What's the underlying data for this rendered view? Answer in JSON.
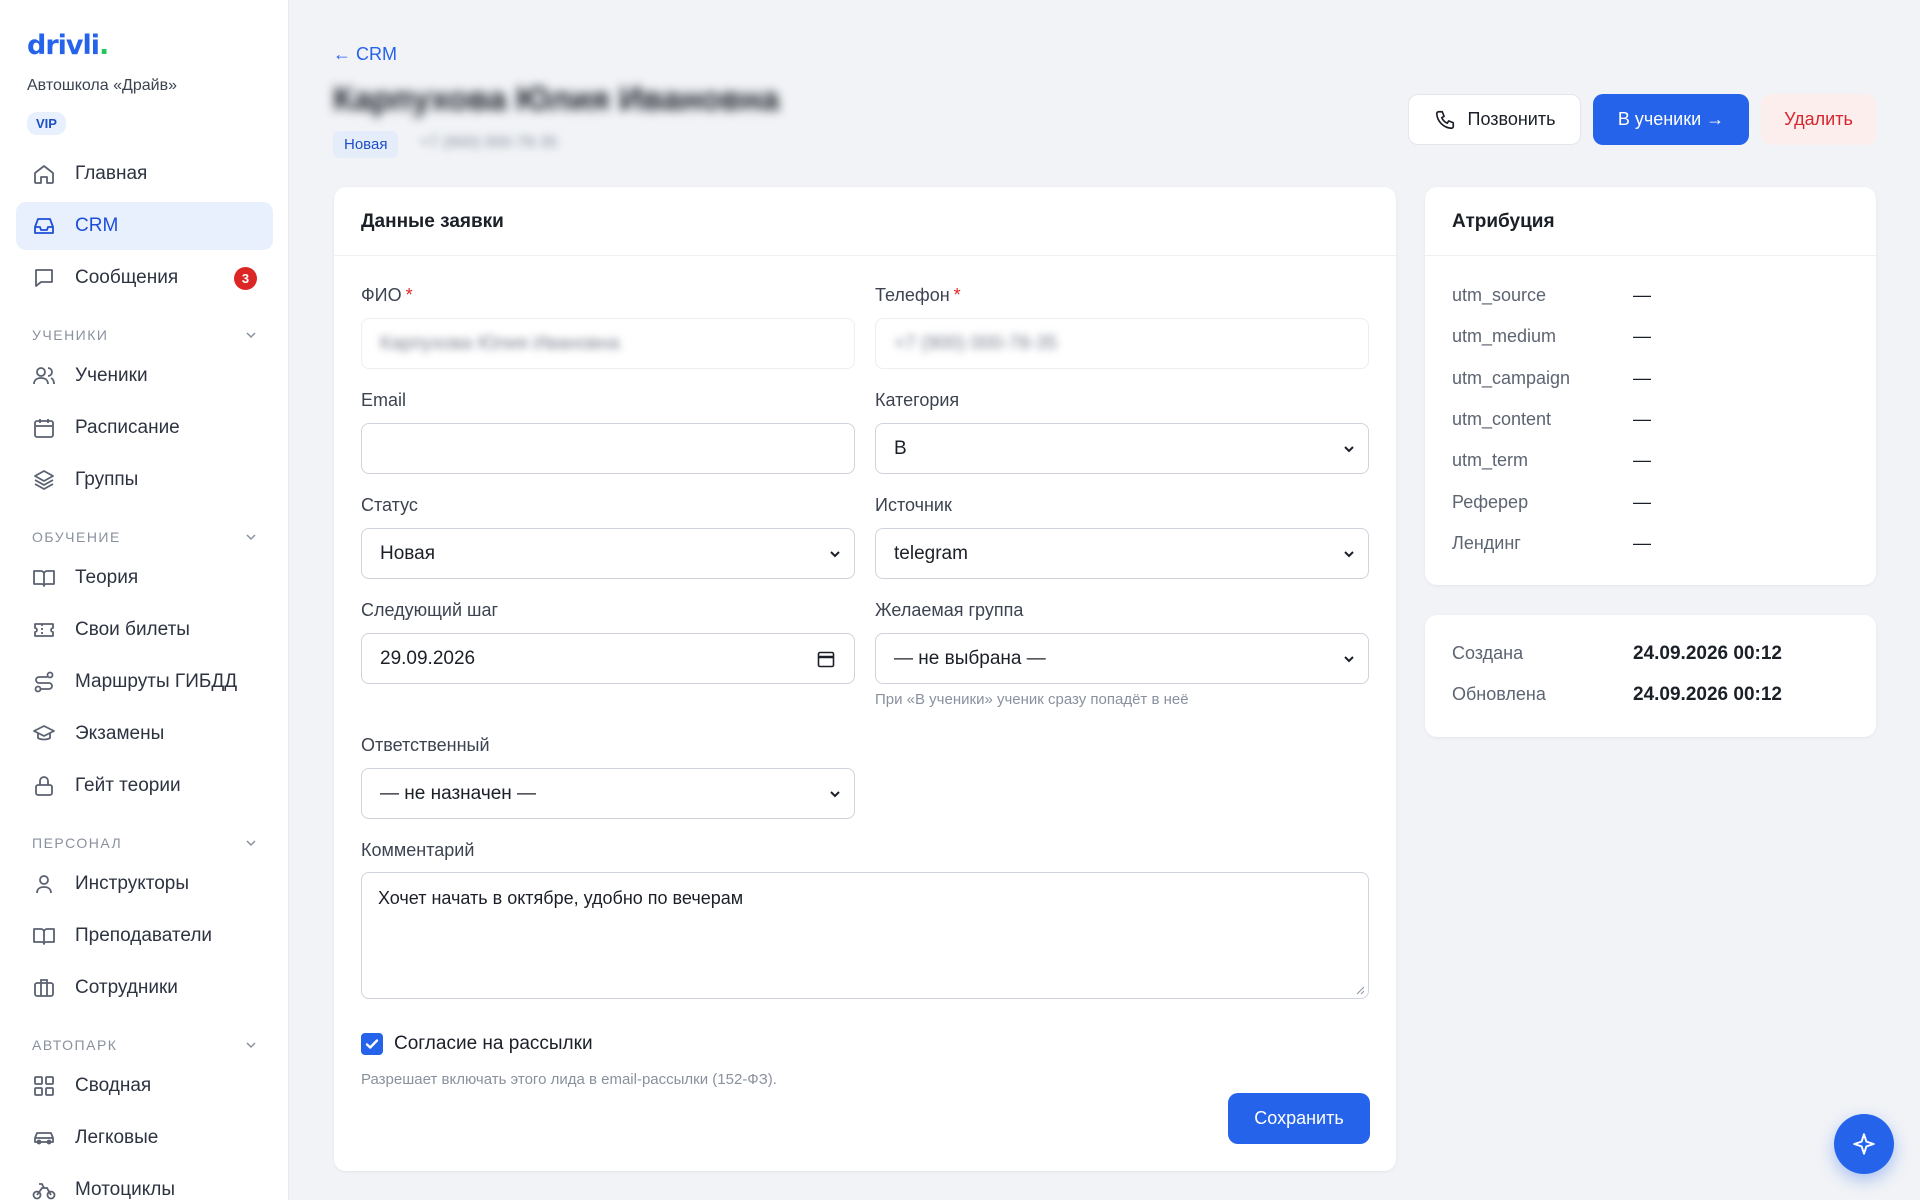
{
  "sidebar": {
    "logo": "drivli",
    "logo_dot": ".",
    "school": "Автошкола «Драйв»",
    "badge": "VIP",
    "top_items": [
      {
        "label": "Главная",
        "icon": "home-icon"
      },
      {
        "label": "CRM",
        "icon": "inbox-icon",
        "active": true
      },
      {
        "label": "Сообщения",
        "icon": "message-icon",
        "count": "3"
      }
    ],
    "sections": [
      {
        "title": "УЧЕНИКИ",
        "items": [
          {
            "label": "Ученики",
            "icon": "users-icon"
          },
          {
            "label": "Расписание",
            "icon": "calendar-icon"
          },
          {
            "label": "Группы",
            "icon": "layers-icon"
          }
        ]
      },
      {
        "title": "ОБУЧЕНИЕ",
        "items": [
          {
            "label": "Теория",
            "icon": "book-icon"
          },
          {
            "label": "Свои билеты",
            "icon": "ticket-icon"
          },
          {
            "label": "Маршруты ГИБДД",
            "icon": "route-icon"
          },
          {
            "label": "Экзамены",
            "icon": "graduation-cap-icon"
          },
          {
            "label": "Гейт теории",
            "icon": "lock-icon"
          }
        ]
      },
      {
        "title": "ПЕРСОНАЛ",
        "items": [
          {
            "label": "Инструкторы",
            "icon": "user-icon"
          },
          {
            "label": "Преподаватели",
            "icon": "book-open-icon"
          },
          {
            "label": "Сотрудники",
            "icon": "briefcase-icon"
          }
        ]
      },
      {
        "title": "АВТОПАРК",
        "items": [
          {
            "label": "Сводная",
            "icon": "grid-icon"
          },
          {
            "label": "Легковые",
            "icon": "car-icon"
          },
          {
            "label": "Мотоциклы",
            "icon": "bike-icon"
          }
        ]
      }
    ]
  },
  "header": {
    "back": "← CRM",
    "title": "Карпухова Юлия Ивановна",
    "status": "Новая",
    "phone": "+7 (900) 000-78-35",
    "call_label": "Позвонить",
    "students_label": "В ученики →",
    "delete_label": "Удалить"
  },
  "form": {
    "title": "Данные заявки",
    "fio_label": "ФИО",
    "fio_value": "Карпухова Юлия Ивановна",
    "phone_label": "Телефон",
    "phone_value": "+7 (900) 000-78-35",
    "required_mark": "*",
    "email_label": "Email",
    "email_value": "",
    "category_label": "Категория",
    "category_value": "B",
    "status_label": "Статус",
    "status_value": "Новая",
    "source_label": "Источник",
    "source_value": "telegram",
    "next_step_label": "Следующий шаг",
    "next_step_value": "29.09.2026",
    "group_label": "Желаемая группа",
    "group_value": "— не выбрана —",
    "group_hint": "При «В ученики» ученик сразу попадёт в неё",
    "responsible_label": "Ответственный",
    "responsible_value": "— не назначен —",
    "comment_label": "Комментарий",
    "comment_value": "Хочет начать в октябре, удобно по вечерам",
    "consent_label": "Согласие на рассылки",
    "consent_checked": true,
    "consent_hint": "Разрешает включать этого лида в email-рассылки (152-ФЗ).",
    "save_label": "Сохранить"
  },
  "attribution": {
    "title": "Атрибуция",
    "rows": [
      {
        "key": "utm_source",
        "value": "—"
      },
      {
        "key": "utm_medium",
        "value": "—"
      },
      {
        "key": "utm_campaign",
        "value": "—"
      },
      {
        "key": "utm_content",
        "value": "—"
      },
      {
        "key": "utm_term",
        "value": "—"
      },
      {
        "key": "Реферер",
        "value": "—"
      },
      {
        "key": "Лендинг",
        "value": "—"
      }
    ]
  },
  "dates": {
    "created_label": "Создана",
    "created_value": "24.09.2026 00:12",
    "updated_label": "Обновлена",
    "updated_value": "24.09.2026 00:12"
  },
  "colors": {
    "accent": "#2563eb",
    "danger": "#dc2626",
    "logo_dot": "#22c55e"
  },
  "fab": {
    "icon": "sparkle-icon"
  }
}
